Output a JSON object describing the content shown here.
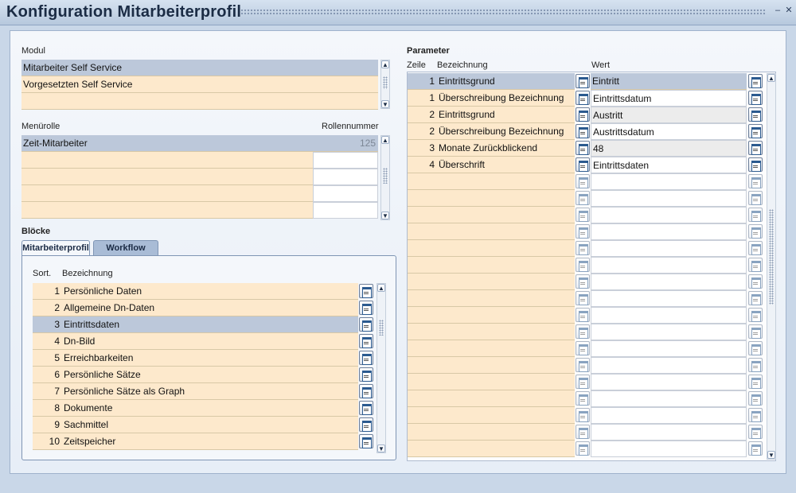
{
  "window": {
    "title": "Konfiguration Mitarbeiterprofil",
    "controls": [
      "minimize-icon",
      "close-icon"
    ]
  },
  "modul": {
    "label": "Modul",
    "rows": [
      "Mitarbeiter Self Service",
      "Vorgesetzten Self Service",
      ""
    ],
    "selected_index": 0
  },
  "menurolle": {
    "label": "Menürolle",
    "number_label": "Rollennummer",
    "rows": [
      {
        "name": "Zeit-Mitarbeiter",
        "number": "125"
      },
      {
        "name": "",
        "number": ""
      },
      {
        "name": "",
        "number": ""
      },
      {
        "name": "",
        "number": ""
      },
      {
        "name": "",
        "number": ""
      }
    ],
    "selected_index": 0
  },
  "bloecke": {
    "label": "Blöcke",
    "tabs": [
      {
        "label": "Mitarbeiterprofil",
        "active": true
      },
      {
        "label": "Workflow",
        "active": false
      }
    ],
    "col_sort": "Sort.",
    "col_name": "Bezeichnung",
    "rows": [
      {
        "sort": "1",
        "name": "Persönliche Daten"
      },
      {
        "sort": "2",
        "name": "Allgemeine Dn-Daten"
      },
      {
        "sort": "3",
        "name": "Eintrittsdaten"
      },
      {
        "sort": "4",
        "name": "Dn-Bild"
      },
      {
        "sort": "5",
        "name": "Erreichbarkeiten"
      },
      {
        "sort": "6",
        "name": "Persönliche Sätze"
      },
      {
        "sort": "7",
        "name": "Persönliche Sätze als Graph"
      },
      {
        "sort": "8",
        "name": "Dokumente"
      },
      {
        "sort": "9",
        "name": "Sachmittel"
      },
      {
        "sort": "10",
        "name": "Zeitspeicher"
      }
    ],
    "selected_index": 2
  },
  "parameter": {
    "label": "Parameter",
    "col_zeile": "Zeile",
    "col_name": "Bezeichnung",
    "col_wert": "Wert",
    "rows": [
      {
        "zeile": "1",
        "name": "Eintrittsgrund",
        "wert": "Eintritt"
      },
      {
        "zeile": "1",
        "name": "Überschreibung Bezeichnung",
        "wert": "Eintrittsdatum"
      },
      {
        "zeile": "2",
        "name": "Eintrittsgrund",
        "wert": "Austritt"
      },
      {
        "zeile": "2",
        "name": "Überschreibung Bezeichnung",
        "wert": "Austrittsdatum"
      },
      {
        "zeile": "3",
        "name": "Monate Zurückblickend",
        "wert": "48"
      },
      {
        "zeile": "4",
        "name": "Überschrift",
        "wert": "Eintrittsdaten"
      },
      {
        "zeile": "",
        "name": "",
        "wert": ""
      },
      {
        "zeile": "",
        "name": "",
        "wert": ""
      },
      {
        "zeile": "",
        "name": "",
        "wert": ""
      },
      {
        "zeile": "",
        "name": "",
        "wert": ""
      },
      {
        "zeile": "",
        "name": "",
        "wert": ""
      },
      {
        "zeile": "",
        "name": "",
        "wert": ""
      },
      {
        "zeile": "",
        "name": "",
        "wert": ""
      },
      {
        "zeile": "",
        "name": "",
        "wert": ""
      },
      {
        "zeile": "",
        "name": "",
        "wert": ""
      },
      {
        "zeile": "",
        "name": "",
        "wert": ""
      },
      {
        "zeile": "",
        "name": "",
        "wert": ""
      },
      {
        "zeile": "",
        "name": "",
        "wert": ""
      },
      {
        "zeile": "",
        "name": "",
        "wert": ""
      },
      {
        "zeile": "",
        "name": "",
        "wert": ""
      },
      {
        "zeile": "",
        "name": "",
        "wert": ""
      },
      {
        "zeile": "",
        "name": "",
        "wert": ""
      },
      {
        "zeile": "",
        "name": "",
        "wert": ""
      }
    ],
    "selected_index": 0,
    "grey_value_rows": [
      2,
      4
    ]
  },
  "icons": {
    "lov": "list-of-values-icon",
    "scroll_up": "scroll-up-icon",
    "scroll_down": "scroll-down-icon"
  },
  "colors": {
    "row": "#fde9cc",
    "selected": "#bcc8da",
    "title": "#1b2c45"
  }
}
